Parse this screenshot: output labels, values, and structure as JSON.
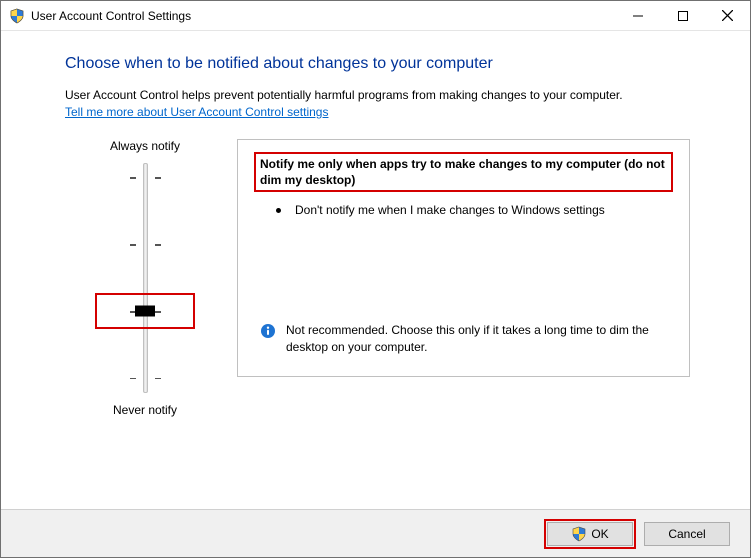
{
  "titlebar": {
    "title": "User Account Control Settings"
  },
  "heading": "Choose when to be notified about changes to your computer",
  "description": "User Account Control helps prevent potentially harmful programs from making changes to your computer.",
  "link": "Tell me more about User Account Control settings",
  "slider": {
    "top_label": "Always notify",
    "bottom_label": "Never notify",
    "level_count": 4,
    "selected_index": 2
  },
  "panel": {
    "title": "Notify me only when apps try to make changes to my computer (do not dim my desktop)",
    "bullet": "Don't notify me when I make changes to Windows settings",
    "recommendation": "Not recommended. Choose this only if it takes a long time to dim the desktop on your computer."
  },
  "footer": {
    "ok_label": "OK",
    "cancel_label": "Cancel"
  }
}
